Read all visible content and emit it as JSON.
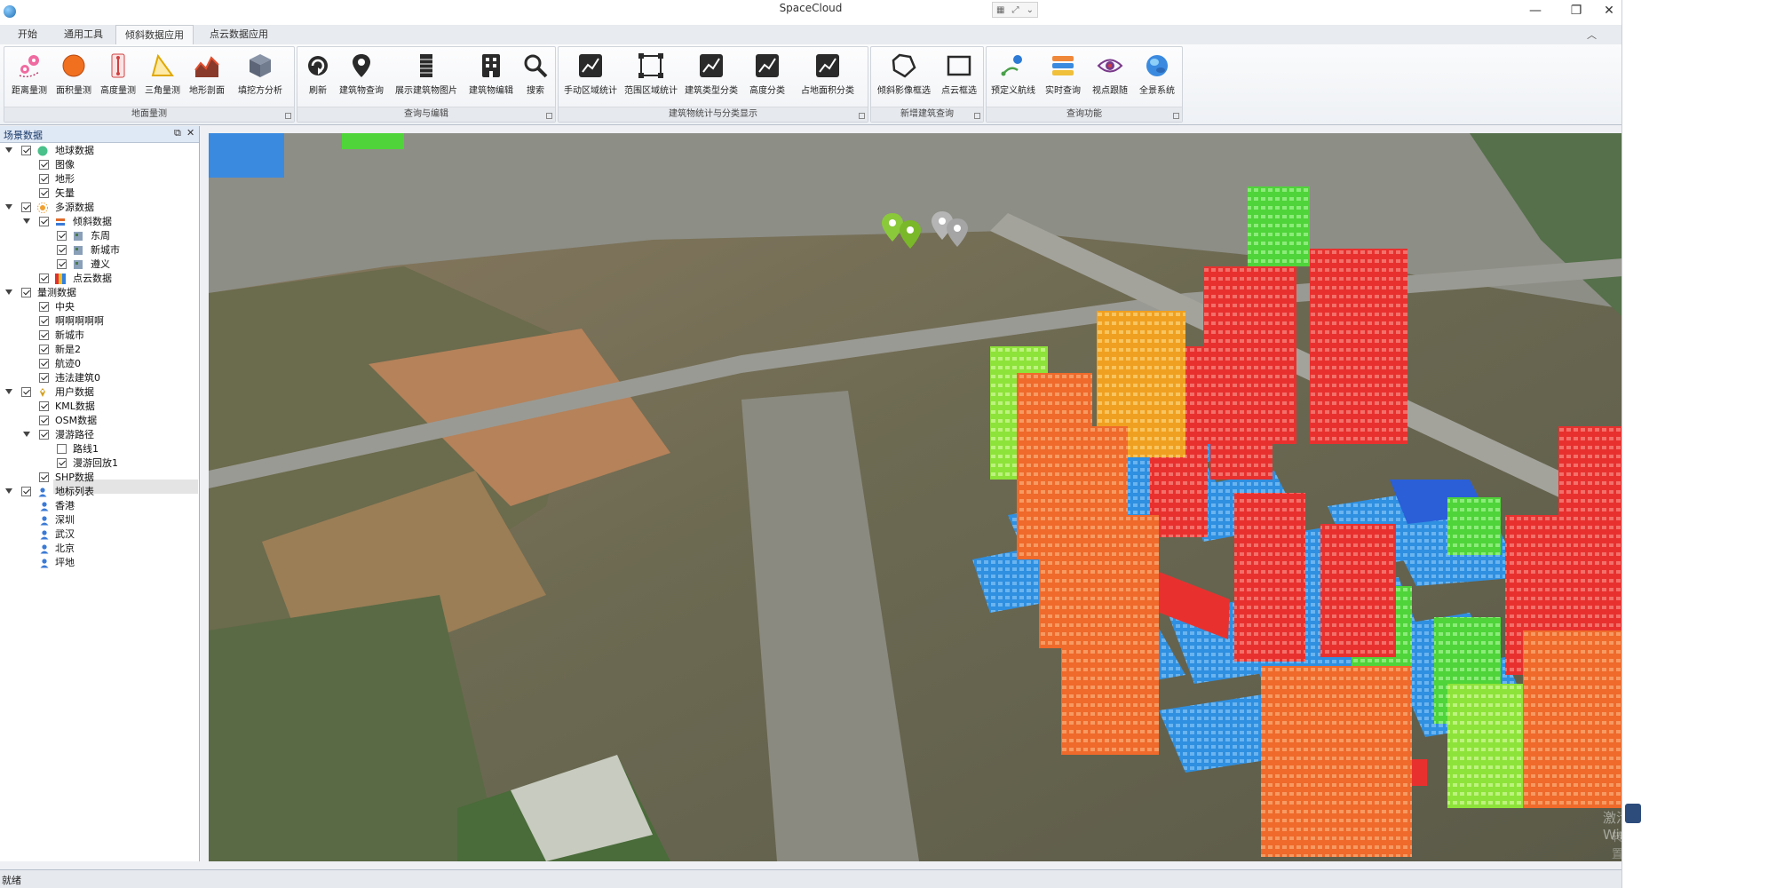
{
  "app": {
    "title": "SpaceCloud"
  },
  "window_buttons": {
    "minimize": "—",
    "maximize": "❐",
    "close": "✕"
  },
  "tabs": [
    {
      "label": "开始"
    },
    {
      "label": "通用工具"
    },
    {
      "label": "倾斜数据应用",
      "active": true
    },
    {
      "label": "点云数据应用"
    }
  ],
  "ribbon": {
    "groups": [
      {
        "label": "地面量测",
        "buttons": [
          "距离量测",
          "面积量测",
          "高度量测",
          "三角量测",
          "地形剖面",
          "填挖方分析"
        ]
      },
      {
        "label": "查询与编辑",
        "buttons": [
          "刷新",
          "建筑物查询",
          "展示建筑物图片",
          "建筑物编辑",
          "搜索"
        ]
      },
      {
        "label": "建筑物统计与分类显示",
        "buttons": [
          "手动区域统计",
          "范围区域统计",
          "建筑类型分类",
          "高度分类",
          "占地面积分类"
        ]
      },
      {
        "label": "新增建筑查询",
        "buttons": [
          "倾斜影像框选",
          "点云框选"
        ]
      },
      {
        "label": "查询功能",
        "buttons": [
          "预定义航线",
          "实时查询",
          "视点跟随",
          "全景系统"
        ]
      }
    ]
  },
  "panel": {
    "title": "场景数据",
    "nodes": [
      {
        "label": "地球数据",
        "checked": true,
        "icon": "globe-icon"
      },
      {
        "label": "图像",
        "checked": true
      },
      {
        "label": "地形",
        "checked": true
      },
      {
        "label": "矢量",
        "checked": true
      },
      {
        "label": "多源数据",
        "checked": true,
        "icon": "sun-icon"
      },
      {
        "label": "倾斜数据",
        "checked": true,
        "icon": "layers-icon"
      },
      {
        "label": "东周",
        "checked": true,
        "icon": "tile-icon"
      },
      {
        "label": "新城市",
        "checked": true,
        "icon": "tile-icon"
      },
      {
        "label": "遵义",
        "checked": true,
        "icon": "tile-icon"
      },
      {
        "label": "点云数据",
        "checked": true,
        "icon": "pointcloud-icon"
      },
      {
        "label": "量测数据",
        "checked": true
      },
      {
        "label": "中央",
        "checked": true
      },
      {
        "label": "啊啊啊啊啊",
        "checked": true
      },
      {
        "label": "新城市",
        "checked": true
      },
      {
        "label": "新是2",
        "checked": true
      },
      {
        "label": "航迹0",
        "checked": true
      },
      {
        "label": "违法建筑0",
        "checked": true
      },
      {
        "label": "用户数据",
        "checked": true,
        "icon": "pin-icon"
      },
      {
        "label": "KML数据",
        "checked": true
      },
      {
        "label": "OSM数据",
        "checked": true
      },
      {
        "label": "漫游路径",
        "checked": true
      },
      {
        "label": "路线1",
        "checked": false
      },
      {
        "label": "漫游回放1",
        "checked": true
      },
      {
        "label": "SHP数据",
        "checked": true
      },
      {
        "label": "地标列表",
        "checked": true,
        "icon": "person-icon"
      },
      {
        "label": "香港",
        "icon": "person-icon"
      },
      {
        "label": "深圳",
        "icon": "person-icon"
      },
      {
        "label": "武汉",
        "icon": "person-icon"
      },
      {
        "label": "北京",
        "icon": "person-icon"
      },
      {
        "label": "坪地",
        "icon": "person-icon"
      }
    ]
  },
  "scene": {
    "watermark_line1": "激活 Windows",
    "watermark_line2": "转到\"设置\"以激活 Windows。"
  },
  "status": {
    "text": "就绪"
  },
  "colors": {
    "building_red": "#e8312f",
    "building_orange": "#ef6a2b",
    "building_amber": "#f0a020",
    "building_green": "#4fd43a",
    "building_lime": "#8ee33a",
    "building_blue": "#2f8fe0",
    "building_navy": "#2a5fd8",
    "terrain": "#7a6a4a"
  }
}
